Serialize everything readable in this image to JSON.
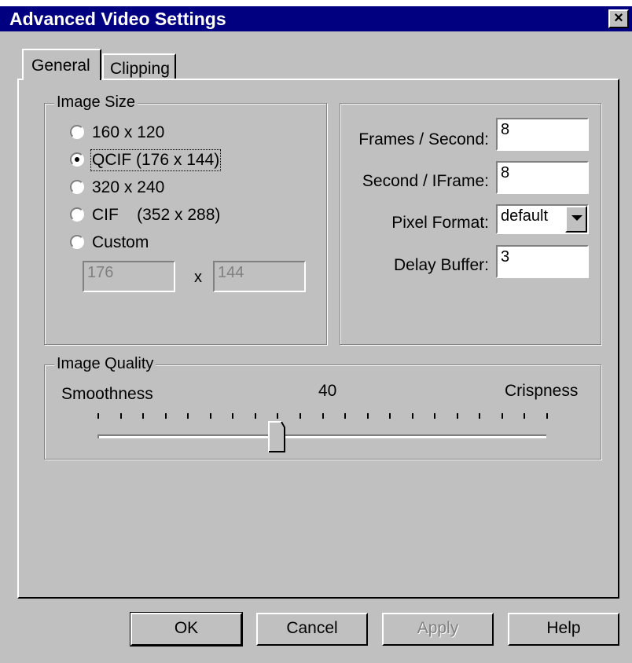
{
  "window": {
    "title": "Advanced Video Settings",
    "close_label": "×"
  },
  "tabs": [
    {
      "label": "General",
      "active": true
    },
    {
      "label": "Clipping",
      "active": false
    }
  ],
  "image_size": {
    "legend": "Image Size",
    "options": [
      {
        "label": "160 x 120",
        "selected": false
      },
      {
        "label": "QCIF (176 x 144)",
        "selected": true
      },
      {
        "label": "320 x 240",
        "selected": false
      },
      {
        "label": "CIF    (352 x 288)",
        "selected": false
      },
      {
        "label": "Custom",
        "selected": false
      }
    ],
    "custom_width": "176",
    "custom_separator": "x",
    "custom_height": "144"
  },
  "settings": {
    "frames_per_second_label": "Frames / Second:",
    "frames_per_second_value": "8",
    "second_per_iframe_label": "Second / IFrame:",
    "second_per_iframe_value": "8",
    "pixel_format_label": "Pixel Format:",
    "pixel_format_value": "default",
    "delay_buffer_label": "Delay Buffer:",
    "delay_buffer_value": "3"
  },
  "image_quality": {
    "legend": "Image Quality",
    "min_label": "Smoothness",
    "max_label": "Crispness",
    "value": "40",
    "slider_fraction": 0.4
  },
  "buttons": {
    "ok": "OK",
    "cancel": "Cancel",
    "apply": "Apply",
    "help": "Help"
  },
  "colors": {
    "titlebar": "#000080",
    "face": "#c0c0c0"
  }
}
